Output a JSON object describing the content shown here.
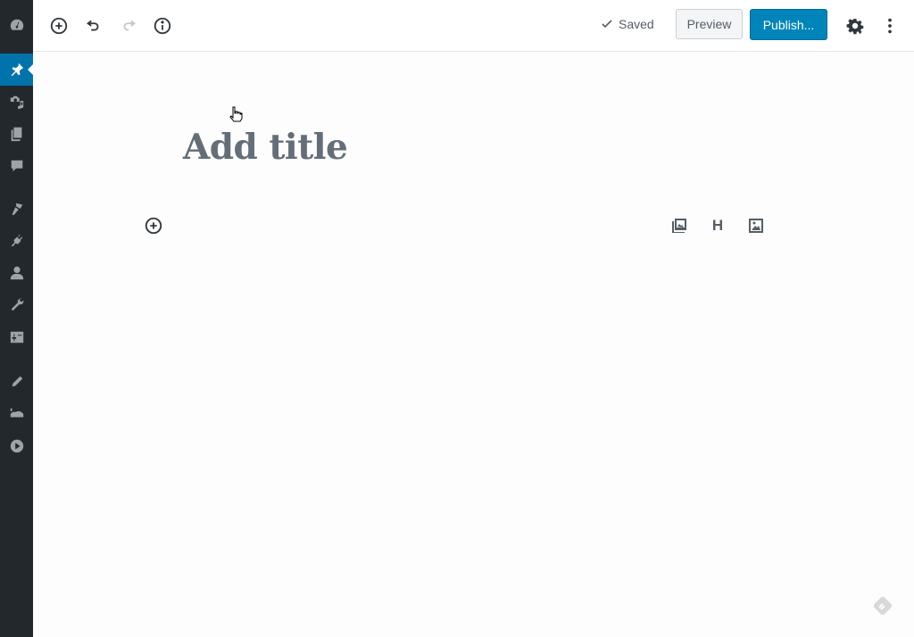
{
  "sidebar": {
    "items": [
      {
        "name": "dashboard",
        "icon": "dashboard-icon"
      },
      {
        "name": "posts",
        "icon": "pin-icon",
        "active": true
      },
      {
        "name": "media",
        "icon": "media-icon"
      },
      {
        "name": "pages",
        "icon": "pages-icon"
      },
      {
        "name": "comments",
        "icon": "comment-icon"
      },
      {
        "name": "appearance",
        "icon": "paintbrush-icon"
      },
      {
        "name": "plugins",
        "icon": "plugin-icon"
      },
      {
        "name": "users",
        "icon": "user-icon"
      },
      {
        "name": "tools",
        "icon": "wrench-icon"
      },
      {
        "name": "settings",
        "icon": "settings-icon"
      },
      {
        "name": "edit",
        "icon": "pencil-icon"
      },
      {
        "name": "collapse-bar",
        "icon": "bar-icon"
      },
      {
        "name": "play",
        "icon": "play-icon"
      }
    ]
  },
  "toolbar": {
    "saved_label": "Saved",
    "preview_label": "Preview",
    "publish_label": "Publish..."
  },
  "editor": {
    "title_placeholder": "Add title",
    "quick_blocks": [
      "gallery",
      "heading",
      "image"
    ],
    "heading_label": "H"
  },
  "colors": {
    "accent": "#0085ba",
    "sidebar_bg": "#23282d",
    "active_item": "#0073aa"
  }
}
